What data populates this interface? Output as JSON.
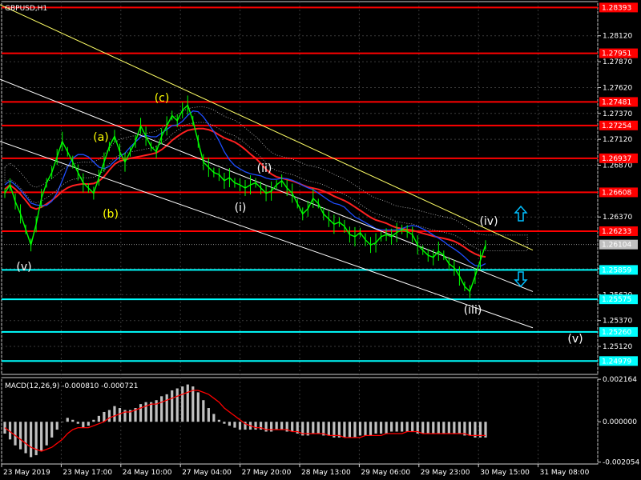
{
  "chart_data": [
    {
      "type": "candlestick",
      "title": "GBPUSD,H1",
      "background": "#000000",
      "price_axis_ticks": [
        "1.28120",
        "1.27870",
        "1.27620",
        "1.27370",
        "1.27120",
        "1.26870",
        "1.26370",
        "1.25870",
        "1.25620",
        "1.25370",
        "1.25120"
      ],
      "time_axis_labels": [
        "23 May 2019",
        "23 May 17:00",
        "24 May 10:00",
        "27 May 04:00",
        "27 May 20:00",
        "28 May 13:00",
        "29 May 06:00",
        "29 May 23:00",
        "30 May 15:00",
        "31 May 08:00"
      ],
      "current_price": "1.26104",
      "current_price_value": 1.26104,
      "ylim": [
        1.2485,
        1.2845
      ],
      "resistance_levels": [
        {
          "label": "1.28393",
          "value": 1.28393,
          "color": "#ff0000"
        },
        {
          "label": "1.27951",
          "value": 1.27951,
          "color": "#ff0000"
        },
        {
          "label": "1.27481",
          "value": 1.27481,
          "color": "#ff0000"
        },
        {
          "label": "1.27254",
          "value": 1.27254,
          "color": "#ff0000"
        },
        {
          "label": "1.26937",
          "value": 1.26937,
          "color": "#ff0000"
        },
        {
          "label": "1.26608",
          "value": 1.26608,
          "color": "#ff0000"
        },
        {
          "label": "1.26233",
          "value": 1.26233,
          "color": "#ff0000"
        }
      ],
      "support_levels": [
        {
          "label": "1.25859",
          "value": 1.25859,
          "color": "#00ffff"
        },
        {
          "label": "1.25575",
          "value": 1.25575,
          "color": "#00ffff"
        },
        {
          "label": "1.25260",
          "value": 1.2526,
          "color": "#00ffff"
        },
        {
          "label": "1.24979",
          "value": 1.24979,
          "color": "#00ffff"
        }
      ],
      "wave_labels": [
        {
          "text": "(a)",
          "color": "#ffff00"
        },
        {
          "text": "(b)",
          "color": "#ffff00"
        },
        {
          "text": "(c)",
          "color": "#ffff00"
        },
        {
          "text": "(v)",
          "color": "#ffffff"
        },
        {
          "text": "(i)",
          "color": "#ffffff"
        },
        {
          "text": "(ii)",
          "color": "#ffffff"
        },
        {
          "text": "(iii)",
          "color": "#ffffff"
        },
        {
          "text": "(iv)",
          "color": "#ffffff"
        },
        {
          "text": "(v)",
          "color": "#ffffff"
        }
      ],
      "arrows": [
        {
          "direction": "up",
          "color": "#00bfff"
        },
        {
          "direction": "down",
          "color": "#00bfff"
        }
      ],
      "series": [
        {
          "color": "#00ff00",
          "close": [
            1.266,
            1.2668,
            1.2652,
            1.264,
            1.2625,
            1.261,
            1.263,
            1.2655,
            1.267,
            1.268,
            1.2695,
            1.271,
            1.27,
            1.269,
            1.268,
            1.267,
            1.2665,
            1.266,
            1.2675,
            1.269,
            1.2705,
            1.2715,
            1.27,
            1.269,
            1.27,
            1.271,
            1.2725,
            1.2715,
            1.2705,
            1.27,
            1.2715,
            1.2725,
            1.2735,
            1.273,
            1.274,
            1.2745,
            1.273,
            1.271,
            1.269,
            1.2685,
            1.268,
            1.2678,
            1.2672,
            1.2675,
            1.267,
            1.2668,
            1.2665,
            1.2668,
            1.267,
            1.2665,
            1.266,
            1.2662,
            1.2668,
            1.2672,
            1.2665,
            1.266,
            1.265,
            1.264,
            1.2645,
            1.2655,
            1.265,
            1.264,
            1.2635,
            1.263,
            1.2632,
            1.2628,
            1.262,
            1.2618,
            1.2622,
            1.2615,
            1.261,
            1.2612,
            1.2618,
            1.262,
            1.2618,
            1.2622,
            1.2625,
            1.2623,
            1.262,
            1.261,
            1.2605,
            1.26,
            1.2598,
            1.2604,
            1.26,
            1.2592,
            1.2588,
            1.258,
            1.257,
            1.2565,
            1.258,
            1.2595,
            1.261
          ]
        }
      ]
    },
    {
      "type": "bar",
      "title": "MACD(12,26,9) -0.000810 -0.000721",
      "yticks": [
        "0.002164",
        "0.000000",
        "-0.002054"
      ],
      "ylim": [
        -0.00215,
        0.00225
      ],
      "macd_values": [
        -0.0006,
        -0.0009,
        -0.0012,
        -0.0014,
        -0.0016,
        -0.0018,
        -0.0017,
        -0.0015,
        -0.0012,
        -0.0008,
        -0.0004,
        0.0,
        0.0002,
        0.0001,
        -0.0001,
        -0.0003,
        -0.0002,
        0.0001,
        0.0003,
        0.0005,
        0.0006,
        0.0008,
        0.0007,
        0.0006,
        0.0006,
        0.0007,
        0.0009,
        0.001,
        0.001,
        0.0011,
        0.0013,
        0.0014,
        0.0016,
        0.0017,
        0.0018,
        0.0019,
        0.0018,
        0.0015,
        0.0011,
        0.0007,
        0.0004,
        0.0001,
        -0.0001,
        -0.0002,
        -0.0003,
        -0.0004,
        -0.0004,
        -0.0004,
        -0.0004,
        -0.0004,
        -0.0005,
        -0.0005,
        -0.0004,
        -0.0004,
        -0.0005,
        -0.0005,
        -0.0006,
        -0.0007,
        -0.0007,
        -0.0006,
        -0.0006,
        -0.0007,
        -0.0007,
        -0.0008,
        -0.0008,
        -0.0008,
        -0.0008,
        -0.0008,
        -0.0007,
        -0.0007,
        -0.0007,
        -0.0006,
        -0.0006,
        -0.0006,
        -0.0005,
        -0.0005,
        -0.0005,
        -0.0005,
        -0.0005,
        -0.0006,
        -0.0006,
        -0.0006,
        -0.0006,
        -0.0006,
        -0.0006,
        -0.0006,
        -0.0006,
        -0.0006,
        -0.0007,
        -0.0007,
        -0.0008,
        -0.0008,
        -0.0008
      ],
      "signal_values": [
        -0.0003,
        -0.0005,
        -0.0007,
        -0.0009,
        -0.0011,
        -0.0013,
        -0.0014,
        -0.0015,
        -0.0014,
        -0.0013,
        -0.0011,
        -0.0009,
        -0.0006,
        -0.0004,
        -0.0003,
        -0.0003,
        -0.0003,
        -0.0002,
        -0.0001,
        0.0,
        0.0002,
        0.0003,
        0.0004,
        0.0005,
        0.0005,
        0.0006,
        0.0007,
        0.0008,
        0.0009,
        0.0009,
        0.001,
        0.0011,
        0.0012,
        0.0013,
        0.0014,
        0.0015,
        0.0016,
        0.0016,
        0.0015,
        0.0014,
        0.0012,
        0.001,
        0.0007,
        0.0005,
        0.0003,
        0.0001,
        -0.0001,
        -0.0002,
        -0.0003,
        -0.0003,
        -0.0004,
        -0.0004,
        -0.0004,
        -0.0004,
        -0.0004,
        -0.0005,
        -0.0005,
        -0.0006,
        -0.0006,
        -0.0006,
        -0.0006,
        -0.0006,
        -0.0007,
        -0.0007,
        -0.0007,
        -0.0008,
        -0.0008,
        -0.0008,
        -0.0008,
        -0.0007,
        -0.0007,
        -0.0007,
        -0.0007,
        -0.0006,
        -0.0006,
        -0.0006,
        -0.0006,
        -0.0005,
        -0.0005,
        -0.0005,
        -0.0006,
        -0.0006,
        -0.0006,
        -0.0006,
        -0.0006,
        -0.0006,
        -0.0006,
        -0.0006,
        -0.0006,
        -0.0007,
        -0.0007,
        -0.0007,
        -0.0007
      ],
      "bar_color": "#c0c0c0",
      "signal_color": "#ff0000"
    }
  ]
}
